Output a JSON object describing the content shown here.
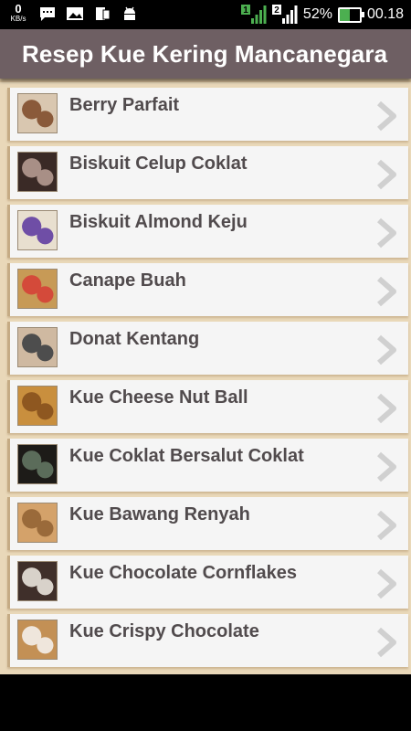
{
  "status_bar": {
    "net_speed": "0",
    "net_unit": "KB/s",
    "sim1": "1",
    "sim2": "2",
    "battery_percent": "52%",
    "battery_level": 0.52,
    "time": "00.18"
  },
  "app_bar": {
    "title": "Resep Kue Kering Mancanegara"
  },
  "recipes": [
    {
      "label": "Berry Parfait",
      "thumb_colors": [
        "#d9c7b0",
        "#8a5a3a"
      ]
    },
    {
      "label": "Biskuit Celup Coklat",
      "thumb_colors": [
        "#3a2a26",
        "#a88f86"
      ]
    },
    {
      "label": "Biskuit Almond Keju",
      "thumb_colors": [
        "#e8dfcf",
        "#6f4ea6"
      ]
    },
    {
      "label": "Canape Buah",
      "thumb_colors": [
        "#c79a56",
        "#d44a3a"
      ]
    },
    {
      "label": "Donat Kentang",
      "thumb_colors": [
        "#cfb9a1",
        "#4d4d4d"
      ]
    },
    {
      "label": "Kue Cheese Nut Ball",
      "thumb_colors": [
        "#c98f3e",
        "#8e5720"
      ]
    },
    {
      "label": "Kue Coklat Bersalut Coklat",
      "thumb_colors": [
        "#1d1b18",
        "#5b6c5a"
      ]
    },
    {
      "label": "Kue Bawang Renyah",
      "thumb_colors": [
        "#d4a26a",
        "#9a6a3a"
      ]
    },
    {
      "label": "Kue Chocolate Cornflakes",
      "thumb_colors": [
        "#3f2f2a",
        "#d8d2ca"
      ]
    },
    {
      "label": "Kue Crispy Chocolate",
      "thumb_colors": [
        "#c39055",
        "#efe6dc"
      ]
    }
  ],
  "colors": {
    "app_bar": "#6e5f63",
    "list_bg": "#e9d8b9",
    "row_bg": "#f5f5f5",
    "row_text": "#514b4d",
    "chevron": "#d0d0d0"
  }
}
